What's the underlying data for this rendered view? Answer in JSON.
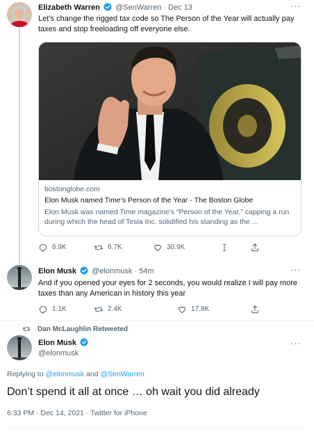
{
  "tweet1": {
    "name": "Elizabeth Warren",
    "handle": "@SenWarren",
    "separator": "·",
    "time": "Dec 13",
    "text": "Let’s change the rigged tax code so The Person of the Year will actually pay taxes and stop freeloading off everyone else.",
    "card": {
      "domain": "bostonglobe.com",
      "title": "Elon Musk named Time’s Person of the Year - The Boston Globe",
      "description": "Elon Musk was named Time magazine’s “Person of the Year,” capping a run during which the head of Tesla Inc. solidified his standing as the ..."
    },
    "actions": {
      "replies": "6.9K",
      "retweets": "6.7K",
      "likes": "30.9K"
    }
  },
  "tweet2": {
    "name": "Elon Musk",
    "handle": "@elonmusk",
    "separator": "·",
    "time": "54m",
    "text": "And if you opened your eyes for 2 seconds, you would realize I will pay more taxes than any American in history this year",
    "actions": {
      "replies": "1.1K",
      "retweets": "2.4K",
      "likes": "17.8K"
    }
  },
  "retweet_banner": "Dan McLaughlin Retweeted",
  "tweet3": {
    "name": "Elon Musk",
    "handle": "@elonmusk",
    "replying_prefix": "Replying to",
    "replying_user1": "@elonmusk",
    "replying_and": "and",
    "replying_user2": "@SenWarren",
    "text": "Don’t spend it all at once … oh wait you did already",
    "meta": "6:33 PM · Dec 14, 2021 · Twitter for iPhone"
  },
  "more_glyph": "···",
  "colors": {
    "verified": "#1d9bf0",
    "link": "#1d9bf0",
    "secondary": "#536471"
  }
}
